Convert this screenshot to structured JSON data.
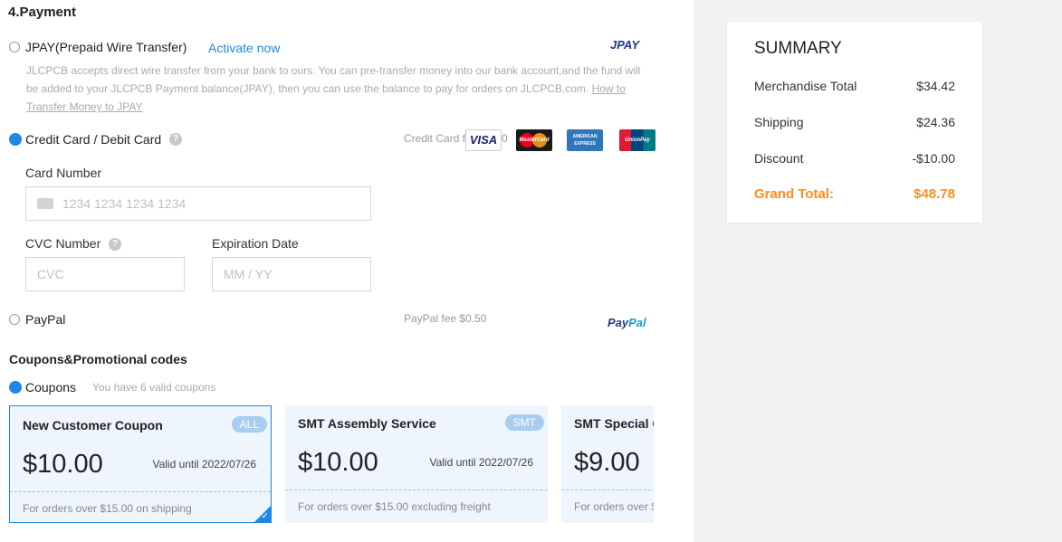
{
  "payment": {
    "title": "4.Payment",
    "jpay": {
      "label": "JPAY(Prepaid Wire Transfer)",
      "activate": "Activate now",
      "logo_text": "JPAY",
      "desc_line1": "JLCPCB accepts direct wire transfer from your bank to ours. You can pre-transfer money into our bank account,and the fund will",
      "desc_line2_pre": "be added to your JLCPCB Payment balance(JPAY), then you can use the balance to pay for orders on JLCPCB.com. ",
      "desc_link_part1": "How to",
      "desc_link_part2": "Transfer Money to JPAY"
    },
    "card": {
      "label": "Credit Card / Debit Card",
      "fee": "Credit Card fee $0.00",
      "logos": [
        "VISA",
        "MasterCard",
        "AMERICAN EXPRESS",
        "UnionPay"
      ],
      "card_number_label": "Card Number",
      "card_number_placeholder": "1234 1234 1234 1234",
      "cvc_label": "CVC Number",
      "cvc_placeholder": "CVC",
      "exp_label": "Expiration Date",
      "exp_placeholder": "MM / YY"
    },
    "paypal": {
      "label": "PayPal",
      "fee": "PayPal fee $0.50",
      "logo_pay": "Pay",
      "logo_pal": "Pal"
    }
  },
  "coupons_section": {
    "title": "Coupons&Promotional codes",
    "label": "Coupons",
    "valid_count": "You have 6 valid coupons",
    "items": [
      {
        "name": "New Customer Coupon",
        "badge": "ALL",
        "amount": "$10.00",
        "valid": "Valid until 2022/07/26",
        "condition": "For orders over $15.00 on shipping"
      },
      {
        "name": "SMT Assembly Service",
        "badge": "SMT",
        "amount": "$10.00",
        "valid": "Valid until 2022/07/26",
        "condition": "For orders over $15.00 excluding freight"
      },
      {
        "name": "SMT Special Coupon",
        "badge": "",
        "amount": "$9.00",
        "valid": "",
        "condition": "For orders over $"
      }
    ]
  },
  "summary": {
    "title": "SUMMARY",
    "rows": [
      {
        "label": "Merchandise Total",
        "value": "$34.42"
      },
      {
        "label": "Shipping",
        "value": "$24.36"
      },
      {
        "label": "Discount",
        "value": "-$10.00"
      }
    ],
    "grand_label": "Grand Total:",
    "grand_value": "$48.78"
  },
  "colors": {
    "accent": "#1e88e5",
    "grand_total": "#ff8c1a"
  }
}
